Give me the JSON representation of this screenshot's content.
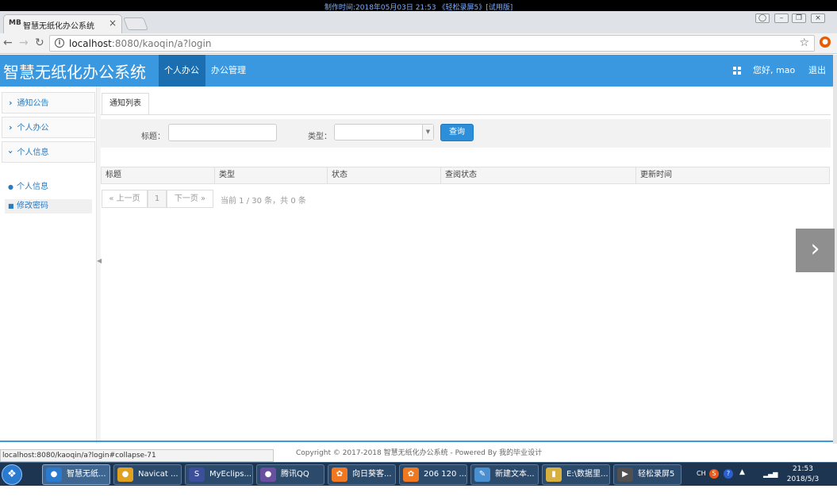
{
  "recording": {
    "banner": "制作时间:2018年05月03日 21:53 《轻松录屏5》[试用版]"
  },
  "browser": {
    "tab_favicon": "MB",
    "tab_title": "智慧无纸化办公系统",
    "tab_close": "×",
    "url_host": "localhost",
    "url_rest": ":8080/kaoqin/a?login",
    "status_url": "localhost:8080/kaoqin/a?login#collapse-71"
  },
  "app": {
    "title": "智慧无纸化办公系统",
    "nav": [
      {
        "label": "个人办公"
      },
      {
        "label": "办公管理"
      }
    ],
    "greeting": "您好, mao",
    "logout": "退出"
  },
  "sidebar": {
    "groups": [
      {
        "label": "通知公告",
        "expanded": false
      },
      {
        "label": "个人办公",
        "expanded": false
      },
      {
        "label": "个人信息",
        "expanded": true
      }
    ],
    "sub_items": [
      {
        "label": "个人信息",
        "icon": "user-icon"
      },
      {
        "label": "修改密码",
        "icon": "lock-icon"
      }
    ]
  },
  "content": {
    "tab_label": "通知列表",
    "search": {
      "title_label": "标题：",
      "title_value": "",
      "type_label": "类型：",
      "type_value": "",
      "query_button": "查询"
    },
    "table": {
      "columns": [
        "标题",
        "类型",
        "状态",
        "查阅状态",
        "更新时间"
      ],
      "rows": []
    },
    "pager": {
      "prev": "« 上一页",
      "current": "1",
      "next": "下一页 »",
      "info": "当前 1 / 30 条，共 0 条"
    }
  },
  "footer": {
    "copyright": "Copyright © 2017-2018 智慧无纸化办公系统 - Powered By 我的毕业设计"
  },
  "taskbar": {
    "items": [
      {
        "label": "智慧无纸...",
        "color": "#2a7bd0"
      },
      {
        "label": "Navicat ...",
        "color": "#e0a020"
      },
      {
        "label": "MyEclips...",
        "color": "#3b4f9a"
      },
      {
        "label": "腾讯QQ",
        "color": "#6a4fa0"
      },
      {
        "label": "向日葵客...",
        "color": "#f07820"
      },
      {
        "label": "206 120 ...",
        "color": "#f07820"
      },
      {
        "label": "新建文本...",
        "color": "#4a8fd0"
      },
      {
        "label": "E:\\数据里...",
        "color": "#d8b040"
      },
      {
        "label": "轻松录屏5",
        "color": "#505050"
      }
    ],
    "tray": {
      "lang": "CH",
      "time": "21:53",
      "date": "2018/5/3"
    }
  },
  "colors": {
    "header_bg": "#3a98e0",
    "nav_active_bg": "#1b6fb0",
    "link": "#2a7bc0",
    "query_btn": "#2d8fd9"
  }
}
